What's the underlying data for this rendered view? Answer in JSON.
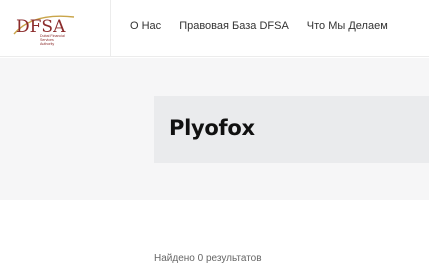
{
  "logo": {
    "mark_text": "DFSA",
    "subtitle_lines": [
      "Dubai Financial",
      "Services",
      "Authority"
    ],
    "brand_color": "#8b2b2b",
    "gold_color": "#c9a54a"
  },
  "nav": {
    "items": [
      {
        "label": "О Нас"
      },
      {
        "label": "Правовая База DFSA"
      },
      {
        "label": "Что Мы Делаем"
      }
    ]
  },
  "hero": {
    "title": "Plyofox"
  },
  "results": {
    "count_text": "Найдено 0 результатов"
  }
}
